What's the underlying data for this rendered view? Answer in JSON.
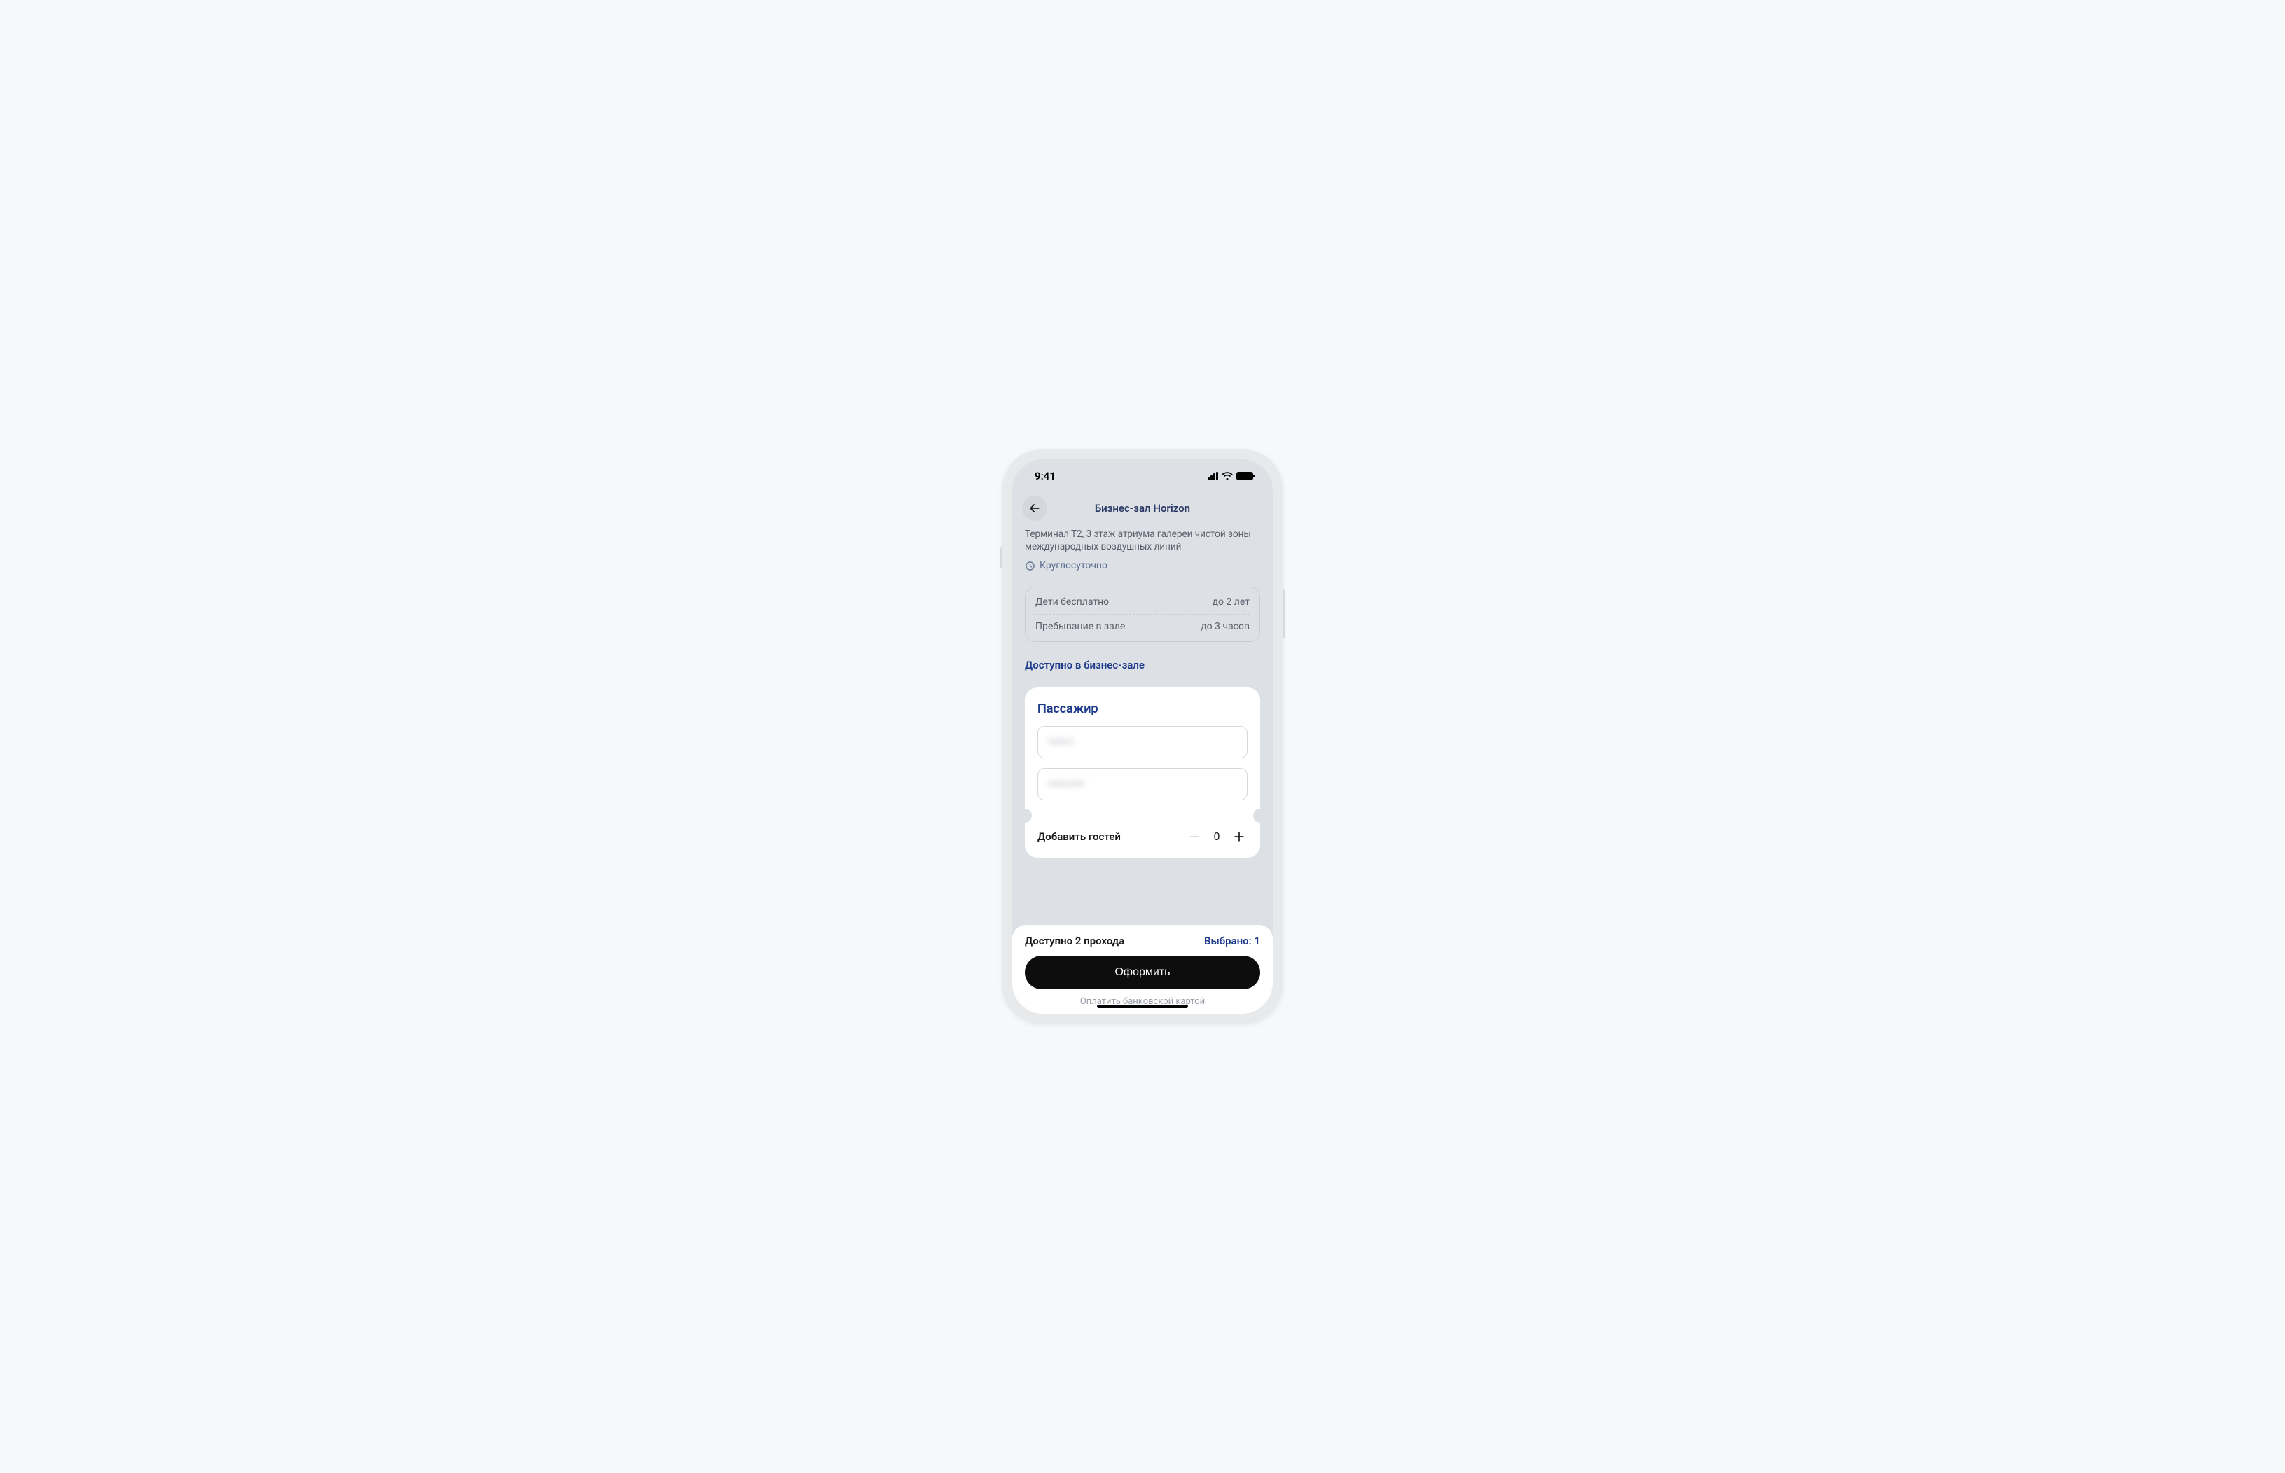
{
  "statusbar": {
    "time": "9:41"
  },
  "nav": {
    "title": "Бизнес-зал Horizon"
  },
  "location": "Терминал Т2, 3 этаж атриума галереи чистой зоны международных воздушных линий",
  "hours": "Круглосуточно",
  "info": {
    "children_label": "Дети бесплатно",
    "children_value": "до 2 лет",
    "stay_label": "Пребывание в зале",
    "stay_value": "до 3 часов"
  },
  "amenities_link": "Доступно в бизнес-зале",
  "passenger": {
    "title": "Пассажир",
    "field1": "redact",
    "field2": "redacted",
    "add_guests_label": "Добавить гостей",
    "guest_count": "0"
  },
  "footer": {
    "available": "Доступно 2 прохода",
    "selected": "Выбрано: 1",
    "primary": "Оформить",
    "paylink": "Оплатить банковской картой"
  }
}
